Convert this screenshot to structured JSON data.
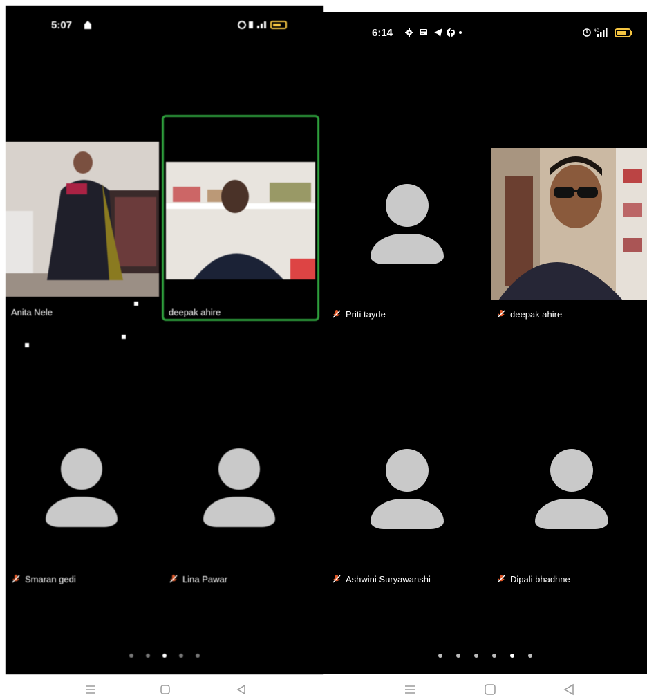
{
  "left_phone": {
    "status_time": "5:07",
    "participants": [
      {
        "name": "Anita Nele",
        "video": true,
        "muted": false
      },
      {
        "name": "deepak ahire",
        "video": true,
        "muted": false,
        "active_speaker": true
      },
      {
        "name": "Smaran gedi",
        "video": false,
        "muted": true
      },
      {
        "name": "Lina Pawar",
        "video": false,
        "muted": true
      }
    ],
    "page_dots": {
      "count": 5,
      "active_index": 2
    }
  },
  "right_phone": {
    "status_time": "6:14",
    "participants": [
      {
        "name": "Priti  tayde",
        "video": false,
        "muted": true
      },
      {
        "name": "deepak ahire",
        "video": true,
        "muted": true
      },
      {
        "name": "Ashwini Suryawanshi",
        "video": false,
        "muted": true
      },
      {
        "name": "Dipali bhadhne",
        "video": false,
        "muted": true
      }
    ],
    "page_dots": {
      "count": 6,
      "active_index": 4
    }
  },
  "colors": {
    "background": "#000000",
    "avatar": "#c9c9c9",
    "active_speaker_border": "#2e9e3c",
    "battery": "#f5c542",
    "nav_icons": "#9a9a9a"
  },
  "icons": [
    "settings-icon",
    "message-icon",
    "telegram-icon",
    "facebook-icon",
    "alarm-icon",
    "signal-icon",
    "battery-icon",
    "mic-muted-icon",
    "menu-nav-icon",
    "home-nav-icon",
    "back-nav-icon"
  ]
}
